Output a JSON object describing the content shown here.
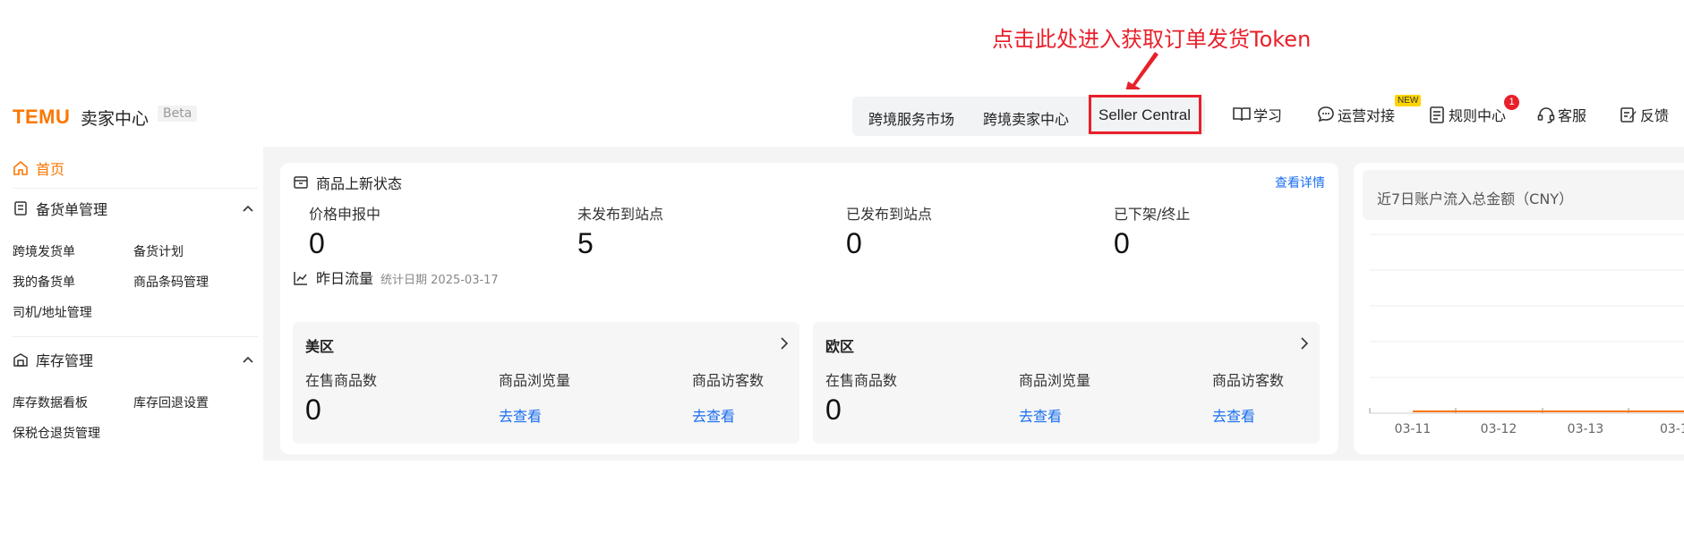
{
  "annotation": {
    "text": "点击此处进入获取订单发货Token",
    "color": "#e8202a"
  },
  "brand": {
    "logo": "TEMU",
    "app_name": "卖家中心",
    "beta": "Beta",
    "accent": "#fb7701"
  },
  "top_nav": {
    "items": [
      "跨境服务市场",
      "跨境卖家中心"
    ],
    "highlighted": "Seller Central",
    "tools": [
      {
        "label": "学习",
        "icon": "book-icon"
      },
      {
        "label": "运营对接",
        "icon": "chat-icon",
        "badge": "NEW"
      },
      {
        "label": "规则中心",
        "icon": "document-icon",
        "badge": "1"
      },
      {
        "label": "客服",
        "icon": "headset-icon"
      },
      {
        "label": "反馈",
        "icon": "edit-icon"
      }
    ]
  },
  "sidebar": {
    "home": "首页",
    "groups": [
      {
        "title": "备货单管理",
        "icon": "clipboard-icon",
        "items": [
          "跨境发货单",
          "备货计划",
          "我的备货单",
          "商品条码管理",
          "司机/地址管理"
        ]
      },
      {
        "title": "库存管理",
        "icon": "warehouse-icon",
        "items": [
          "库存数据看板",
          "库存回退设置",
          "保税仓退货管理"
        ]
      }
    ]
  },
  "product_status": {
    "title": "商品上新状态",
    "detail_link": "查看详情",
    "stats": [
      {
        "label": "价格申报中",
        "value": "0"
      },
      {
        "label": "未发布到站点",
        "value": "5"
      },
      {
        "label": "已发布到站点",
        "value": "0"
      },
      {
        "label": "已下架/终止",
        "value": "0"
      }
    ]
  },
  "traffic": {
    "title": "昨日流量",
    "date_label": "统计日期 2025-03-17",
    "regions": [
      {
        "name": "美区",
        "on_sale_label": "在售商品数",
        "on_sale_value": "0",
        "views_label": "商品浏览量",
        "views_link": "去查看",
        "visitors_label": "商品访客数",
        "visitors_link": "去查看"
      },
      {
        "name": "欧区",
        "on_sale_label": "在售商品数",
        "on_sale_value": "0",
        "views_label": "商品浏览量",
        "views_link": "去查看",
        "visitors_label": "商品访客数",
        "visitors_link": "去查看"
      }
    ]
  },
  "inflow_chart": {
    "title": "近7日账户流入总金额（CNY）",
    "x_ticks": [
      "03-11",
      "03-12",
      "03-13",
      "03-1"
    ],
    "line_color": "#fb7701"
  }
}
